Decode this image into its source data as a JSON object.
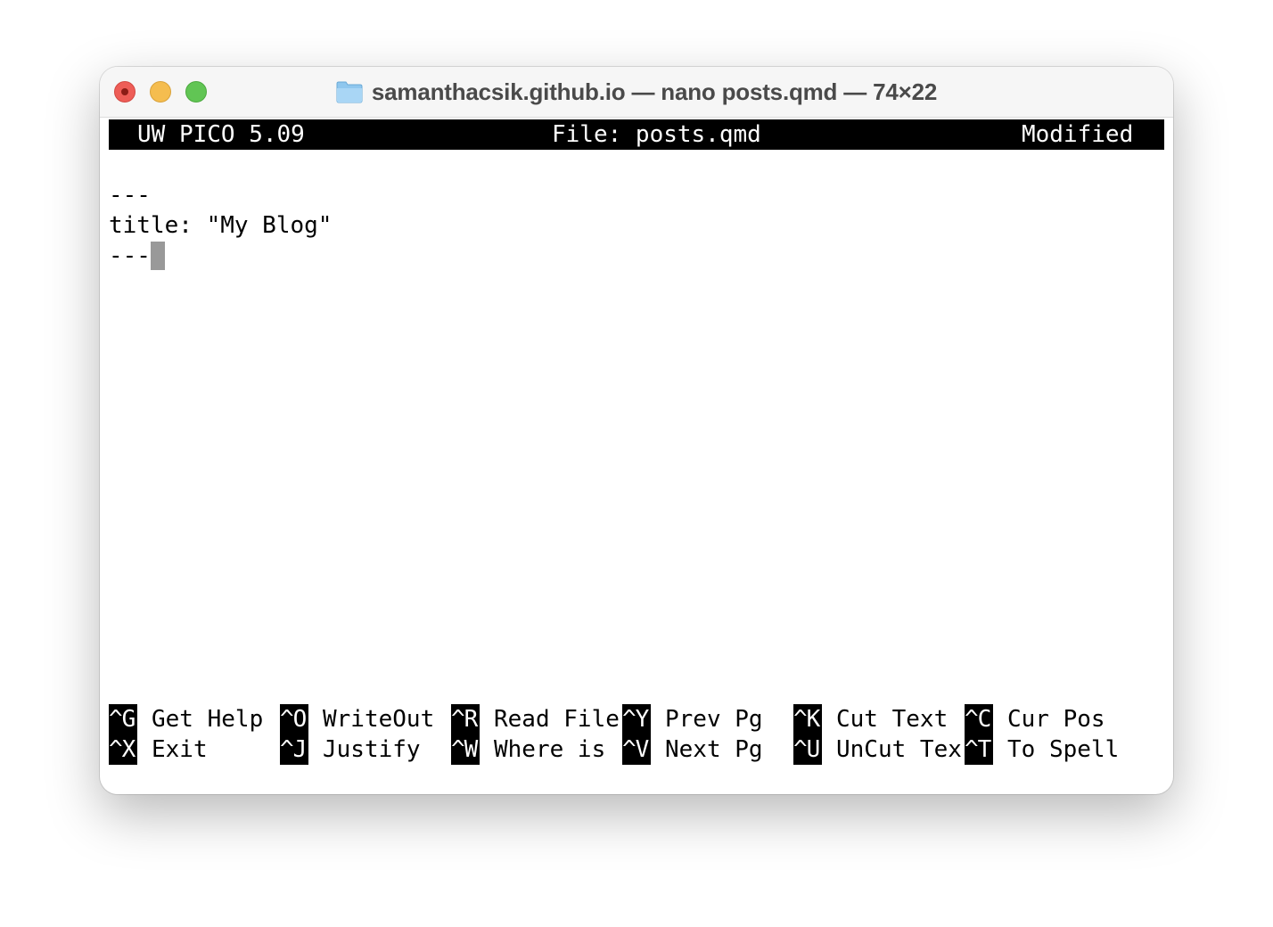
{
  "window": {
    "title": "samanthacsik.github.io — nano posts.qmd — 74×22"
  },
  "editor": {
    "version": "UW PICO 5.09",
    "file": "File: posts.qmd",
    "status": "Modified",
    "lines": [
      "---",
      "title: \"My Blog\"",
      "---"
    ]
  },
  "shortcuts": {
    "row1": [
      {
        "key": "^G",
        "label": "Get Help"
      },
      {
        "key": "^O",
        "label": "WriteOut"
      },
      {
        "key": "^R",
        "label": "Read File"
      },
      {
        "key": "^Y",
        "label": "Prev Pg"
      },
      {
        "key": "^K",
        "label": "Cut Text"
      },
      {
        "key": "^C",
        "label": "Cur Pos"
      }
    ],
    "row2": [
      {
        "key": "^X",
        "label": "Exit"
      },
      {
        "key": "^J",
        "label": "Justify"
      },
      {
        "key": "^W",
        "label": "Where is"
      },
      {
        "key": "^V",
        "label": "Next Pg"
      },
      {
        "key": "^U",
        "label": "UnCut Tex"
      },
      {
        "key": "^T",
        "label": "To Spell"
      }
    ]
  },
  "icons": {
    "folder": "folder-icon",
    "close": "close-icon",
    "minimize": "minimize-icon",
    "zoom": "zoom-icon"
  }
}
